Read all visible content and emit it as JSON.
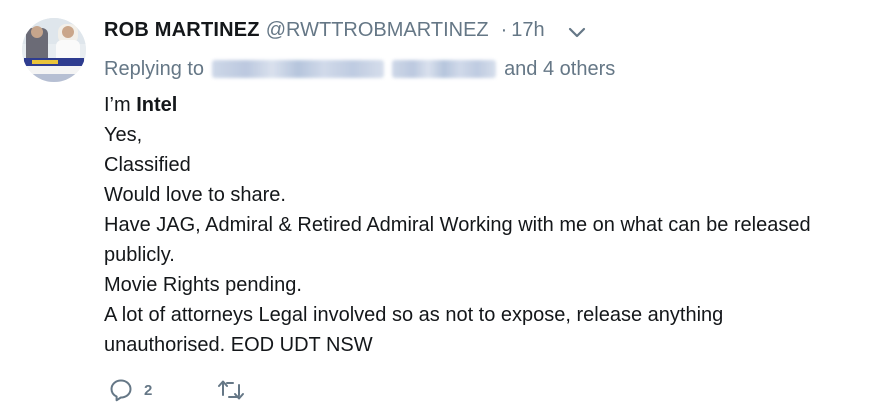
{
  "tweet": {
    "author_name": "ROB MARTINEZ",
    "author_handle": "@RWTTROBMARTINEZ",
    "separator": "·",
    "timestamp": "17h",
    "replying_prefix": "Replying to",
    "replying_suffix": "and 4 others",
    "body_lines": [
      {
        "pre": "I’m ",
        "bold": "Intel"
      },
      {
        "pre": "Yes,"
      },
      {
        "pre": "Classified"
      },
      {
        "pre": "Would love to share."
      },
      {
        "pre": "Have JAG, Admiral & Retired Admiral Working with me on what can be released"
      },
      {
        "pre": "publicly."
      },
      {
        "pre": "Movie Rights pending."
      },
      {
        "pre": "A lot of attorneys Legal involved so as not to expose, release anything"
      },
      {
        "pre": "unauthorised. EOD UDT NSW"
      }
    ],
    "reply_count": "2"
  },
  "icons": {
    "caret": "chevron-down-icon",
    "reply": "reply-bubble-icon",
    "retweet": "retweet-icon"
  },
  "colors": {
    "text_primary": "#14171a",
    "text_secondary": "#657786",
    "background": "#ffffff"
  }
}
